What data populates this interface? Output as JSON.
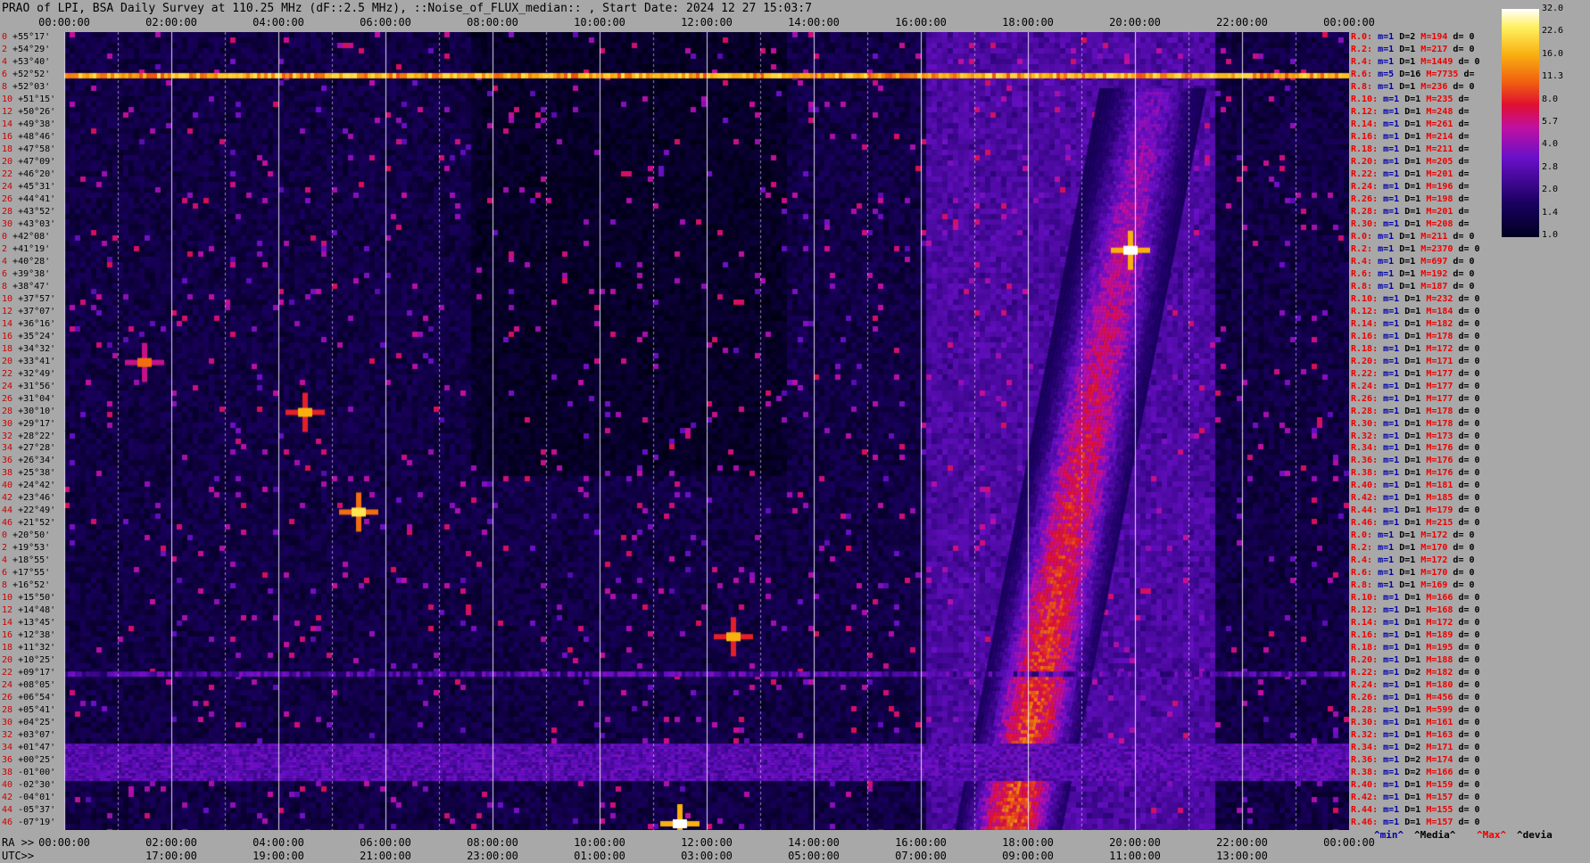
{
  "title": "PRAO of LPI, BSA Daily Survey at 110.25 MHz (dF::2.5 MHz), ::Noise_of_FLUX_median:: , Start Date: 2024 12 27 15:03:7",
  "top_axis": [
    "00:00:00",
    "02:00:00",
    "04:00:00",
    "06:00:00",
    "08:00:00",
    "10:00:00",
    "12:00:00",
    "14:00:00",
    "16:00:00",
    "18:00:00",
    "20:00:00",
    "22:00:00",
    "00:00:00"
  ],
  "bottom_axis_prefix": "RA >>",
  "bottom_axis": [
    "00:00:00",
    "02:00:00",
    "04:00:00",
    "06:00:00",
    "08:00:00",
    "10:00:00",
    "12:00:00",
    "14:00:00",
    "16:00:00",
    "18:00:00",
    "20:00:00",
    "22:00:00",
    "00:00:00"
  ],
  "utc_prefix": "UTC>>",
  "utc_axis": [
    "17:00:00",
    "19:00:00",
    "21:00:00",
    "23:00:00",
    "01:00:00",
    "03:00:00",
    "05:00:00",
    "07:00:00",
    "09:00:00",
    "11:00:00",
    "13:00:00"
  ],
  "declinations": [
    "+55°17'",
    "+54°29'",
    "+53°40'",
    "+52°52'",
    "+52°03'",
    "+51°15'",
    "+50°26'",
    "+49°38'",
    "+48°46'",
    "+47°58'",
    "+47°09'",
    "+46°20'",
    "+45°31'",
    "+44°41'",
    "+43°52'",
    "+43°03'",
    "+42°08'",
    "+41°19'",
    "+40°28'",
    "+39°38'",
    "+38°47'",
    "+37°57'",
    "+37°07'",
    "+36°16'",
    "+35°24'",
    "+34°32'",
    "+33°41'",
    "+32°49'",
    "+31°56'",
    "+31°04'",
    "+30°10'",
    "+29°17'",
    "+28°22'",
    "+27°28'",
    "+26°34'",
    "+25°38'",
    "+24°42'",
    "+23°46'",
    "+22°49'",
    "+21°52'",
    "+20°50'",
    "+19°53'",
    "+18°55'",
    "+17°55'",
    "+16°52'",
    "+15°50'",
    "+14°48'",
    "+13°45'",
    "+12°38'",
    "+11°32'",
    "+10°25'",
    "+09°17'",
    "+08°05'",
    "+06°54'",
    "+05°41'",
    "+04°25'",
    "+03°07'",
    "+01°47'",
    "+00°25'",
    "-01°00'",
    "-02°30'",
    "-04°01'",
    "-05°37'",
    "-07°19'"
  ],
  "dec_indices": [
    "0",
    "2",
    "4",
    "6",
    "8",
    "10",
    "12",
    "14",
    "16",
    "18",
    "20",
    "22",
    "24",
    "26",
    "28",
    "30",
    "0",
    "2",
    "4",
    "6",
    "8",
    "10",
    "12",
    "14",
    "16",
    "18",
    "20",
    "22",
    "24",
    "26",
    "28",
    "30",
    "32",
    "34",
    "36",
    "38",
    "40",
    "42",
    "44",
    "46",
    "0",
    "2",
    "4",
    "6",
    "8",
    "10",
    "12",
    "14",
    "16",
    "18",
    "20",
    "22",
    "24",
    "26",
    "28",
    "30",
    "32",
    "34",
    "36",
    "38",
    "40",
    "42",
    "44",
    "46"
  ],
  "right_rows": [
    {
      "r": "R.0:",
      "m": "m=1",
      "D": "D=2",
      "M": "M=194",
      "d": "d= 0"
    },
    {
      "r": "R.2:",
      "m": "m=1",
      "D": "D=1",
      "M": "M=217",
      "d": "d= 0"
    },
    {
      "r": "R.4:",
      "m": "m=1",
      "D": "D=1",
      "M": "M=1449",
      "d": "d= 0"
    },
    {
      "r": "R.6:",
      "m": "m=5",
      "D": "D=16",
      "M": "M=7735",
      "d": "d="
    },
    {
      "r": "R.8:",
      "m": "m=1",
      "D": "D=1",
      "M": "M=236",
      "d": "d= 0"
    },
    {
      "r": "R.10:",
      "m": "m=1",
      "D": "D=1",
      "M": "M=235",
      "d": "d="
    },
    {
      "r": "R.12:",
      "m": "m=1",
      "D": "D=1",
      "M": "M=248",
      "d": "d="
    },
    {
      "r": "R.14:",
      "m": "m=1",
      "D": "D=1",
      "M": "M=261",
      "d": "d="
    },
    {
      "r": "R.16:",
      "m": "m=1",
      "D": "D=1",
      "M": "M=214",
      "d": "d="
    },
    {
      "r": "R.18:",
      "m": "m=1",
      "D": "D=1",
      "M": "M=211",
      "d": "d="
    },
    {
      "r": "R.20:",
      "m": "m=1",
      "D": "D=1",
      "M": "M=205",
      "d": "d="
    },
    {
      "r": "R.22:",
      "m": "m=1",
      "D": "D=1",
      "M": "M=201",
      "d": "d="
    },
    {
      "r": "R.24:",
      "m": "m=1",
      "D": "D=1",
      "M": "M=196",
      "d": "d="
    },
    {
      "r": "R.26:",
      "m": "m=1",
      "D": "D=1",
      "M": "M=198",
      "d": "d="
    },
    {
      "r": "R.28:",
      "m": "m=1",
      "D": "D=1",
      "M": "M=201",
      "d": "d="
    },
    {
      "r": "R.30:",
      "m": "m=1",
      "D": "D=1",
      "M": "M=208",
      "d": "d="
    },
    {
      "r": "R.0:",
      "m": "m=1",
      "D": "D=1",
      "M": "M=211",
      "d": "d= 0"
    },
    {
      "r": "R.2:",
      "m": "m=1",
      "D": "D=1",
      "M": "M=2370",
      "d": "d= 0"
    },
    {
      "r": "R.4:",
      "m": "m=1",
      "D": "D=1",
      "M": "M=697",
      "d": "d= 0"
    },
    {
      "r": "R.6:",
      "m": "m=1",
      "D": "D=1",
      "M": "M=192",
      "d": "d= 0"
    },
    {
      "r": "R.8:",
      "m": "m=1",
      "D": "D=1",
      "M": "M=187",
      "d": "d= 0"
    },
    {
      "r": "R.10:",
      "m": "m=1",
      "D": "D=1",
      "M": "M=232",
      "d": "d= 0"
    },
    {
      "r": "R.12:",
      "m": "m=1",
      "D": "D=1",
      "M": "M=184",
      "d": "d= 0"
    },
    {
      "r": "R.14:",
      "m": "m=1",
      "D": "D=1",
      "M": "M=182",
      "d": "d= 0"
    },
    {
      "r": "R.16:",
      "m": "m=1",
      "D": "D=1",
      "M": "M=178",
      "d": "d= 0"
    },
    {
      "r": "R.18:",
      "m": "m=1",
      "D": "D=1",
      "M": "M=172",
      "d": "d= 0"
    },
    {
      "r": "R.20:",
      "m": "m=1",
      "D": "D=1",
      "M": "M=171",
      "d": "d= 0"
    },
    {
      "r": "R.22:",
      "m": "m=1",
      "D": "D=1",
      "M": "M=177",
      "d": "d= 0"
    },
    {
      "r": "R.24:",
      "m": "m=1",
      "D": "D=1",
      "M": "M=177",
      "d": "d= 0"
    },
    {
      "r": "R.26:",
      "m": "m=1",
      "D": "D=1",
      "M": "M=177",
      "d": "d= 0"
    },
    {
      "r": "R.28:",
      "m": "m=1",
      "D": "D=1",
      "M": "M=178",
      "d": "d= 0"
    },
    {
      "r": "R.30:",
      "m": "m=1",
      "D": "D=1",
      "M": "M=178",
      "d": "d= 0"
    },
    {
      "r": "R.32:",
      "m": "m=1",
      "D": "D=1",
      "M": "M=173",
      "d": "d= 0"
    },
    {
      "r": "R.34:",
      "m": "m=1",
      "D": "D=1",
      "M": "M=176",
      "d": "d= 0"
    },
    {
      "r": "R.36:",
      "m": "m=1",
      "D": "D=1",
      "M": "M=176",
      "d": "d= 0"
    },
    {
      "r": "R.38:",
      "m": "m=1",
      "D": "D=1",
      "M": "M=176",
      "d": "d= 0"
    },
    {
      "r": "R.40:",
      "m": "m=1",
      "D": "D=1",
      "M": "M=181",
      "d": "d= 0"
    },
    {
      "r": "R.42:",
      "m": "m=1",
      "D": "D=1",
      "M": "M=185",
      "d": "d= 0"
    },
    {
      "r": "R.44:",
      "m": "m=1",
      "D": "D=1",
      "M": "M=179",
      "d": "d= 0"
    },
    {
      "r": "R.46:",
      "m": "m=1",
      "D": "D=1",
      "M": "M=215",
      "d": "d= 0"
    },
    {
      "r": "R.0:",
      "m": "m=1",
      "D": "D=1",
      "M": "M=172",
      "d": "d= 0"
    },
    {
      "r": "R.2:",
      "m": "m=1",
      "D": "D=1",
      "M": "M=170",
      "d": "d= 0"
    },
    {
      "r": "R.4:",
      "m": "m=1",
      "D": "D=1",
      "M": "M=172",
      "d": "d= 0"
    },
    {
      "r": "R.6:",
      "m": "m=1",
      "D": "D=1",
      "M": "M=170",
      "d": "d= 0"
    },
    {
      "r": "R.8:",
      "m": "m=1",
      "D": "D=1",
      "M": "M=169",
      "d": "d= 0"
    },
    {
      "r": "R.10:",
      "m": "m=1",
      "D": "D=1",
      "M": "M=166",
      "d": "d= 0"
    },
    {
      "r": "R.12:",
      "m": "m=1",
      "D": "D=1",
      "M": "M=168",
      "d": "d= 0"
    },
    {
      "r": "R.14:",
      "m": "m=1",
      "D": "D=1",
      "M": "M=172",
      "d": "d= 0"
    },
    {
      "r": "R.16:",
      "m": "m=1",
      "D": "D=1",
      "M": "M=189",
      "d": "d= 0"
    },
    {
      "r": "R.18:",
      "m": "m=1",
      "D": "D=1",
      "M": "M=195",
      "d": "d= 0"
    },
    {
      "r": "R.20:",
      "m": "m=1",
      "D": "D=1",
      "M": "M=188",
      "d": "d= 0"
    },
    {
      "r": "R.22:",
      "m": "m=1",
      "D": "D=2",
      "M": "M=182",
      "d": "d= 0"
    },
    {
      "r": "R.24:",
      "m": "m=1",
      "D": "D=1",
      "M": "M=180",
      "d": "d= 0"
    },
    {
      "r": "R.26:",
      "m": "m=1",
      "D": "D=1",
      "M": "M=456",
      "d": "d= 0"
    },
    {
      "r": "R.28:",
      "m": "m=1",
      "D": "D=1",
      "M": "M=599",
      "d": "d= 0"
    },
    {
      "r": "R.30:",
      "m": "m=1",
      "D": "D=1",
      "M": "M=161",
      "d": "d= 0"
    },
    {
      "r": "R.32:",
      "m": "m=1",
      "D": "D=1",
      "M": "M=163",
      "d": "d= 0"
    },
    {
      "r": "R.34:",
      "m": "m=1",
      "D": "D=2",
      "M": "M=171",
      "d": "d= 0"
    },
    {
      "r": "R.36:",
      "m": "m=1",
      "D": "D=2",
      "M": "M=174",
      "d": "d= 0"
    },
    {
      "r": "R.38:",
      "m": "m=1",
      "D": "D=2",
      "M": "M=166",
      "d": "d= 0"
    },
    {
      "r": "R.40:",
      "m": "m=1",
      "D": "D=1",
      "M": "M=159",
      "d": "d= 0"
    },
    {
      "r": "R.42:",
      "m": "m=1",
      "D": "D=1",
      "M": "M=157",
      "d": "d= 0"
    },
    {
      "r": "R.44:",
      "m": "m=1",
      "D": "D=1",
      "M": "M=155",
      "d": "d= 0"
    },
    {
      "r": "R.46:",
      "m": "m=1",
      "D": "D=1",
      "M": "M=157",
      "d": "d= 0"
    }
  ],
  "legend": {
    "min": "^min^",
    "median": "^Media^",
    "max": "^Max^",
    "devia": "^devia"
  },
  "colorbar_labels": [
    "32.0",
    "22.6",
    "16.0",
    "11.3",
    "8.0",
    "5.7",
    "4.0",
    "2.8",
    "2.0",
    "1.4",
    "1.0"
  ],
  "colors": {
    "background": "#a8a8a8",
    "plot_bg": "#000000",
    "accent_red": "#e00000",
    "accent_blue": "#0000aa"
  },
  "chart_data": {
    "type": "heatmap",
    "title": "PRAO of LPI, BSA Daily Survey at 110.25 MHz (dF::2.5 MHz), ::Noise_of_FLUX_median:: , Start Date: 2024 12 27 15:03:7",
    "x_axis": "RA (hours), UTC secondary axis",
    "x_range": [
      "00:00:00",
      "24:00:00"
    ],
    "y_axis": "Declination",
    "y_range": [
      "+55°17'",
      "-07°19'"
    ],
    "colorbar": {
      "min": 1.0,
      "max": 32.0,
      "scale": "log2",
      "ticks": [
        1.0,
        1.4,
        2.0,
        2.8,
        4.0,
        5.7,
        8.0,
        11.3,
        16.0,
        22.6,
        32.0
      ]
    },
    "features": [
      {
        "label": "bright band",
        "dec": "+52°52'",
        "ra_range": [
          "00:00",
          "24:00"
        ],
        "level": 16
      },
      {
        "label": "galactic plane crossing",
        "ra_range": [
          "18:00",
          "21:00"
        ],
        "dec_range": [
          "-07°19'",
          "+52°03'"
        ],
        "level": 8
      },
      {
        "label": "bright source",
        "ra": "19:55",
        "dec": "+41°19'",
        "level": 32
      },
      {
        "label": "bright source",
        "ra": "05:30",
        "dec": "+22°49'",
        "level": 22.6
      },
      {
        "label": "bright source",
        "ra": "12:30",
        "dec": "+12°38'",
        "level": 16
      },
      {
        "label": "bright source",
        "ra": "04:30",
        "dec": "+30°10'",
        "level": 16
      },
      {
        "label": "bright source",
        "ra": "01:30",
        "dec": "+33°41'",
        "level": 11.3
      },
      {
        "label": "bright source",
        "ra": "11:30",
        "dec": "-07°19'",
        "level": 32
      },
      {
        "label": "equatorial band",
        "dec_range": [
          "+01°47'",
          "-01°00'"
        ],
        "ra_range": [
          "00:00",
          "24:00"
        ],
        "level": 2.8
      },
      {
        "label": "horizontal line",
        "dec": "+09°17'",
        "ra_range": [
          "00:00",
          "24:00"
        ],
        "level": 2.8
      }
    ]
  }
}
